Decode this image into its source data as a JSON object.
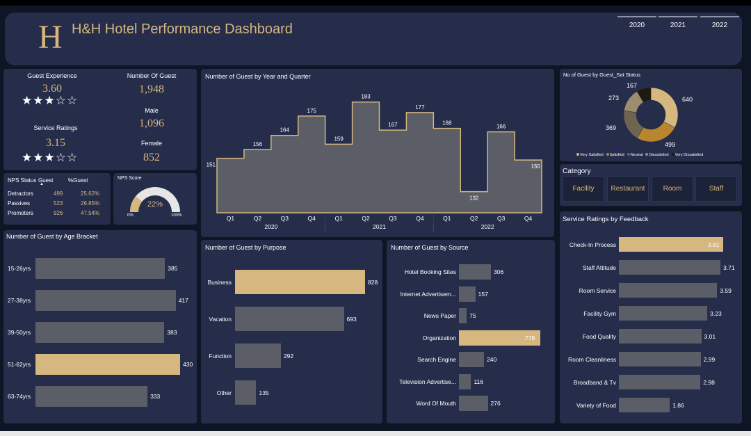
{
  "header": {
    "logo_letter": "H",
    "title": "H&H Hotel Performance Dashboard",
    "years": [
      "2020",
      "2021",
      "2022"
    ]
  },
  "kpi": {
    "guest_experience_label": "Guest Experience",
    "guest_experience_value": "3.60",
    "guest_experience_stars": "★★★☆☆",
    "service_ratings_label": "Service Ratings",
    "service_ratings_value": "3.15",
    "service_ratings_stars": "★★★☆☆",
    "num_guest_label": "Number Of Guest",
    "num_guest_value": "1,948",
    "male_label": "Male",
    "male_value": "1,096",
    "female_label": "Female",
    "female_value": "852"
  },
  "nps_table": {
    "headers": [
      "NPS Status",
      "Guest",
      "%Guest"
    ],
    "sort_icon": "sort-up-icon",
    "rows": [
      {
        "status": "Detractors",
        "guest": "499",
        "pct": "25.62%"
      },
      {
        "status": "Passives",
        "guest": "523",
        "pct": "26.85%"
      },
      {
        "status": "Promoters",
        "guest": "926",
        "pct": "47.54%"
      }
    ]
  },
  "nps_score": {
    "title": "NPS Score",
    "value": "22%",
    "min_label": "0%",
    "max_label": "100%",
    "fraction": 0.22
  },
  "quarter_chart": {
    "title": "Number of Guest by Year and Quarter",
    "quarter_labels": [
      "Q1",
      "Q2",
      "Q3",
      "Q4",
      "Q1",
      "Q2",
      "Q3",
      "Q4",
      "Q1",
      "Q2",
      "Q3",
      "Q4"
    ],
    "year_labels": [
      "2020",
      "2021",
      "2022"
    ],
    "values": [
      151,
      156,
      164,
      175,
      159,
      183,
      167,
      177,
      168,
      132,
      166,
      150
    ]
  },
  "status_chart": {
    "title": "No of Guest by Guest_Sat Status",
    "segments": [
      {
        "name": "Very Satisfied",
        "value": 640,
        "color": "#d6b77f"
      },
      {
        "name": "Satisfied",
        "value": 499,
        "color": "#b8862e"
      },
      {
        "name": "Neutral",
        "value": 369,
        "color": "#6e6450"
      },
      {
        "name": "Dissatisfied",
        "value": 273,
        "color": "#9c8d6d"
      },
      {
        "name": "Very Dissatisfied",
        "value": 167,
        "color": "#1e1a10"
      }
    ]
  },
  "category": {
    "title": "Category",
    "items": [
      "Facility",
      "Restaurant",
      "Room",
      "Staff"
    ]
  },
  "age_chart": {
    "title": "Number of Guest by Age Bracket",
    "items": [
      {
        "label": "15-26yrs",
        "value": 385
      },
      {
        "label": "27-38yrs",
        "value": 417
      },
      {
        "label": "39-50yrs",
        "value": 383
      },
      {
        "label": "51-62yrs",
        "value": 430
      },
      {
        "label": "63-74yrs",
        "value": 333
      }
    ]
  },
  "purpose_chart": {
    "title": "Number of Guest by Purpose",
    "items": [
      {
        "label": "Business",
        "value": 828
      },
      {
        "label": "Vacation",
        "value": 693
      },
      {
        "label": "Function",
        "value": 292
      },
      {
        "label": "Other",
        "value": 135
      }
    ]
  },
  "source_chart": {
    "title": "Number of Guest by Source",
    "items": [
      {
        "label": "Hotel Booking Sites",
        "value": 306
      },
      {
        "label": "Internet Advertisem...",
        "value": 157
      },
      {
        "label": "News Paper",
        "value": 75
      },
      {
        "label": "Organization",
        "value": 778
      },
      {
        "label": "Search Engine",
        "value": 240
      },
      {
        "label": "Television Advertise...",
        "value": 116
      },
      {
        "label": "Word Of Mouth",
        "value": 276
      }
    ]
  },
  "feedback_chart": {
    "title": "Service Ratings by Feedback",
    "items": [
      {
        "label": "Check-In Process",
        "value": "3.81"
      },
      {
        "label": "Staff Attitude",
        "value": "3.71"
      },
      {
        "label": "Room Service",
        "value": "3.59"
      },
      {
        "label": "Facility Gym",
        "value": "3.23"
      },
      {
        "label": "Food Quality",
        "value": "3.01"
      },
      {
        "label": "Room Cleanliness",
        "value": "2.99"
      },
      {
        "label": "Broadband & Tv",
        "value": "2.98"
      },
      {
        "label": "Variety of Food",
        "value": "1.86"
      }
    ]
  },
  "chart_data": [
    {
      "type": "area",
      "title": "Number of Guest by Year and Quarter",
      "categories": [
        "2020 Q1",
        "2020 Q2",
        "2020 Q3",
        "2020 Q4",
        "2021 Q1",
        "2021 Q2",
        "2021 Q3",
        "2021 Q4",
        "2022 Q1",
        "2022 Q2",
        "2022 Q3",
        "2022 Q4"
      ],
      "values": [
        151,
        156,
        164,
        175,
        159,
        183,
        167,
        177,
        168,
        132,
        166,
        150
      ]
    },
    {
      "type": "pie",
      "title": "No of Guest by Guest_Sat Status",
      "categories": [
        "Very Satisfied",
        "Satisfied",
        "Neutral",
        "Dissatisfied",
        "Very Dissatisfied"
      ],
      "values": [
        640,
        499,
        369,
        273,
        167
      ]
    },
    {
      "type": "bar",
      "title": "Number of Guest by Age Bracket",
      "categories": [
        "15-26yrs",
        "27-38yrs",
        "39-50yrs",
        "51-62yrs",
        "63-74yrs"
      ],
      "values": [
        385,
        417,
        383,
        430,
        333
      ]
    },
    {
      "type": "bar",
      "title": "Number of Guest by Purpose",
      "categories": [
        "Business",
        "Vacation",
        "Function",
        "Other"
      ],
      "values": [
        828,
        693,
        292,
        135
      ]
    },
    {
      "type": "bar",
      "title": "Number of Guest by Source",
      "categories": [
        "Hotel Booking Sites",
        "Internet Advertisem...",
        "News Paper",
        "Organization",
        "Search Engine",
        "Television Advertise...",
        "Word Of Mouth"
      ],
      "values": [
        306,
        157,
        75,
        778,
        240,
        116,
        276
      ]
    },
    {
      "type": "bar",
      "title": "Service Ratings by Feedback",
      "categories": [
        "Check-In Process",
        "Staff Attitude",
        "Room Service",
        "Facility Gym",
        "Food Quality",
        "Room Cleanliness",
        "Broadband & Tv",
        "Variety of Food"
      ],
      "values": [
        3.81,
        3.71,
        3.59,
        3.23,
        3.01,
        2.99,
        2.98,
        1.86
      ]
    }
  ]
}
